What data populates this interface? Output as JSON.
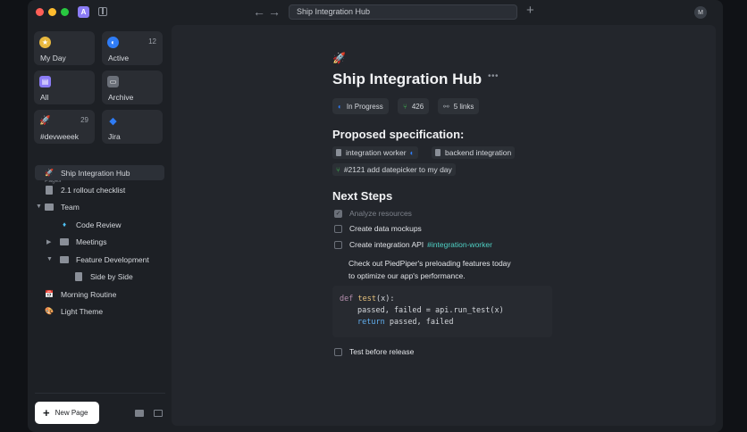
{
  "window": {
    "search_text": "Ship Integration Hub",
    "workspace_initial": "A",
    "user_initial": "M",
    "traffic_lights": {
      "close": "#ff5f57",
      "minimize": "#febc2e",
      "maximize": "#28c840"
    }
  },
  "sidebar": {
    "cards": [
      {
        "label": "My Day",
        "count": "",
        "icon": "sun-icon",
        "color": "#e8b83e"
      },
      {
        "label": "Active",
        "count": "12",
        "icon": "half-circle-icon",
        "color": "#2f7cf6"
      },
      {
        "label": "All",
        "count": "",
        "icon": "stack-icon",
        "color": "#8b7cf6"
      },
      {
        "label": "Archive",
        "count": "",
        "icon": "archive-icon",
        "color": "#6b7079"
      },
      {
        "label": "#devweeek",
        "count": "29",
        "icon": "rocket-icon",
        "color": "#2a2d33"
      },
      {
        "label": "Jira",
        "count": "",
        "icon": "jira-icon",
        "color": "#2f7cf6"
      }
    ],
    "section_label": "Pages",
    "tree": [
      {
        "label": "Ship Integration Hub",
        "icon": "rocket-icon"
      },
      {
        "label": "2.1 rollout checklist",
        "icon": "doc-icon"
      },
      {
        "label": "Team",
        "icon": "folder-icon"
      },
      {
        "label": "Code Review",
        "icon": "gem-icon"
      },
      {
        "label": "Meetings",
        "icon": "folder-icon"
      },
      {
        "label": "Feature Development",
        "icon": "folder-icon"
      },
      {
        "label": "Side by Side",
        "icon": "doc-icon"
      },
      {
        "label": "Morning Routine",
        "icon": "calendar-icon"
      },
      {
        "label": "Light Theme",
        "icon": "palette-icon"
      }
    ],
    "new_page_label": "New Page"
  },
  "page": {
    "emoji": "🚀",
    "title": "Ship Integration Hub",
    "chips": [
      {
        "label": "In Progress",
        "icon": "half-circle-icon"
      },
      {
        "label": "426",
        "icon": "pull-request-icon"
      },
      {
        "label": "5 links",
        "icon": "link-icon"
      }
    ],
    "spec_heading": "Proposed specification:",
    "refs": {
      "integration_worker": "integration worker",
      "backend_integration": "backend integration",
      "pr": "#2121 add datepicker to my day"
    },
    "next_steps_heading": "Next Steps",
    "tasks": [
      {
        "label": "Analyze resources",
        "done": true
      },
      {
        "label": "Create data mockups",
        "done": false
      },
      {
        "label": "Create integration API",
        "tag": "#integration-worker",
        "done": false
      }
    ],
    "bullet_lines": [
      "Check out PiedPiper's preloading features today",
      "to optimize our app's performance."
    ],
    "code": {
      "line1_kw": "def",
      "line1_fn": "test",
      "line1_rest": "(x):",
      "line2": "passed, failed = api.run_test(x)",
      "line3_kw": "return",
      "line3_rest": "passed, failed"
    },
    "final_task": "Test before release"
  }
}
